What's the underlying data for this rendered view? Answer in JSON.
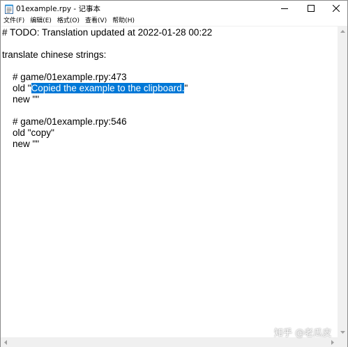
{
  "window": {
    "title": "01example.rpy - 记事本"
  },
  "menu": {
    "items": [
      {
        "label": "文件(F)"
      },
      {
        "label": "编辑(E)"
      },
      {
        "label": "格式(O)"
      },
      {
        "label": "查看(V)"
      },
      {
        "label": "帮助(H)"
      }
    ]
  },
  "editor": {
    "lines": [
      "# TODO: Translation updated at 2022-01-28 00:22",
      "",
      "translate chinese strings:",
      "",
      "    # game/01example.rpy:473",
      "    old \"",
      "Copied the example to the clipboard.",
      "\"",
      "    new \"\"",
      "",
      "    # game/01example.rpy:546",
      "    old \"copy\"",
      "    new \"\""
    ],
    "selected_text": "Copied the example to the clipboard."
  },
  "icons": {
    "app": "notepad-icon",
    "minimize": "minimize-icon",
    "maximize": "maximize-icon",
    "close": "close-icon"
  },
  "colors": {
    "selection": "#0078d7",
    "selection_text": "#ffffff"
  },
  "watermark": {
    "text": "知乎 @老瓜皮"
  }
}
